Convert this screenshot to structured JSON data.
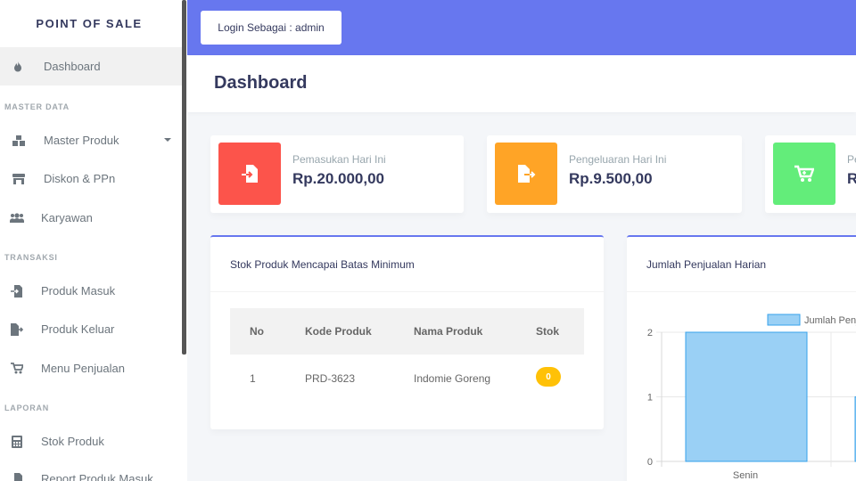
{
  "sidebar": {
    "brand": "POINT OF SALE",
    "dashboard": "Dashboard",
    "header_master": "MASTER DATA",
    "master_produk": "Master Produk",
    "diskon": "Diskon & PPn",
    "karyawan": "Karyawan",
    "header_transaksi": "TRANSAKSI",
    "produk_masuk": "Produk Masuk",
    "produk_keluar": "Produk Keluar",
    "menu_penjualan": "Menu Penjualan",
    "header_laporan": "LAPORAN",
    "stok_produk": "Stok Produk",
    "report_produk_masuk": "Report Produk Masuk"
  },
  "topbar": {
    "login_label": "Login Sebagai : admin"
  },
  "page": {
    "title": "Dashboard"
  },
  "stats": [
    {
      "title": "Pemasukan Hari Ini",
      "value": "Rp.20.000,00",
      "color": "#fc544b",
      "icon": "file-import-icon"
    },
    {
      "title": "Pengeluaran Hari Ini",
      "value": "Rp.9.500,00",
      "color": "#ffa426",
      "icon": "file-export-icon"
    },
    {
      "title": "Pe",
      "value": "R",
      "color": "#63ed7a",
      "icon": "cart-icon"
    }
  ],
  "stock_panel": {
    "title": "Stok Produk Mencapai Batas Minimum",
    "columns": [
      "No",
      "Kode Produk",
      "Nama Produk",
      "Stok"
    ],
    "rows": [
      {
        "no": "1",
        "kode": "PRD-3623",
        "nama": "Indomie Goreng",
        "stok": "0"
      }
    ]
  },
  "sales_panel": {
    "title": "Jumlah Penjualan Harian"
  },
  "chart_data": {
    "type": "bar",
    "categories": [
      "Senin"
    ],
    "series": [
      {
        "name": "Jumlah Penj",
        "values": [
          2
        ]
      }
    ],
    "ylim": [
      0,
      2
    ],
    "yticks": [
      "0",
      "1",
      "2"
    ],
    "grid": true,
    "legend": "top"
  },
  "colors": {
    "accent": "#6777ef",
    "bar_fill": "#9ad0f5",
    "bar_stroke": "#36a2eb"
  }
}
